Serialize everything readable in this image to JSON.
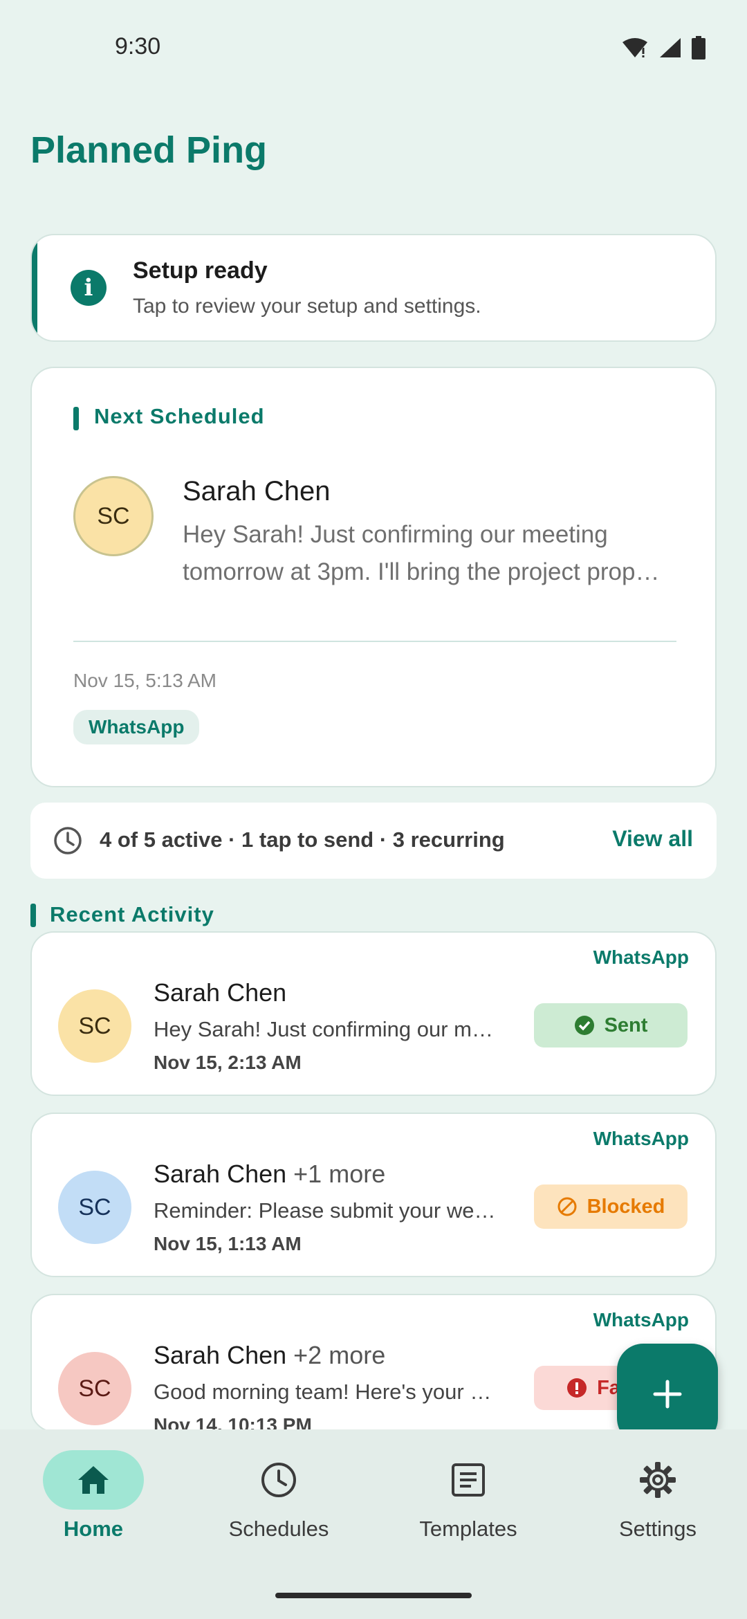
{
  "status_bar": {
    "time": "9:30"
  },
  "app": {
    "title": "Planned Ping"
  },
  "setup_banner": {
    "title": "Setup ready",
    "subtitle": "Tap to review your setup and settings."
  },
  "next_scheduled": {
    "header": "Next Scheduled",
    "initials": "SC",
    "name": "Sarah Chen",
    "message": "Hey Sarah! Just confirming our meeting tomorrow at 3pm. I'll bring the project prop…",
    "datetime": "Nov 15, 5:13 AM",
    "channel": "WhatsApp"
  },
  "stats": {
    "summary": "4 of 5 active · 1 tap to send · 3 recurring",
    "view_all": "View all"
  },
  "recent_activity": {
    "header": "Recent Activity",
    "items": [
      {
        "channel": "WhatsApp",
        "initials": "SC",
        "name": "Sarah Chen",
        "more": "",
        "message": "Hey Sarah! Just confirming our m…",
        "datetime": "Nov 15, 2:13 AM",
        "status": "Sent",
        "avatar_color": "#fae2a6",
        "status_bg": "#cdebd3",
        "status_color": "#2e7d32"
      },
      {
        "channel": "WhatsApp",
        "initials": "SC",
        "name": "Sarah Chen",
        "more": "+1 more",
        "message": "Reminder: Please submit your we…",
        "datetime": "Nov 15, 1:13 AM",
        "status": "Blocked",
        "avatar_color": "#c2ddf6",
        "status_bg": "#fde3bd",
        "status_color": "#e67a00"
      },
      {
        "channel": "WhatsApp",
        "initials": "SC",
        "name": "Sarah Chen",
        "more": "+2 more",
        "message": "Good morning team! Here's your …",
        "datetime": "Nov 14, 10:13 PM",
        "status": "Failed",
        "avatar_color": "#f6c8c2",
        "status_bg": "#fbd9d6",
        "status_color": "#c62828"
      }
    ]
  },
  "bottom_nav": {
    "items": [
      {
        "label": "Home",
        "icon": "home-icon",
        "active": true
      },
      {
        "label": "Schedules",
        "icon": "clock-icon",
        "active": false
      },
      {
        "label": "Templates",
        "icon": "document-icon",
        "active": false
      },
      {
        "label": "Settings",
        "icon": "gear-icon",
        "active": false
      }
    ]
  },
  "colors": {
    "accent": "#0b7a6a",
    "background": "#e8f3ef"
  }
}
